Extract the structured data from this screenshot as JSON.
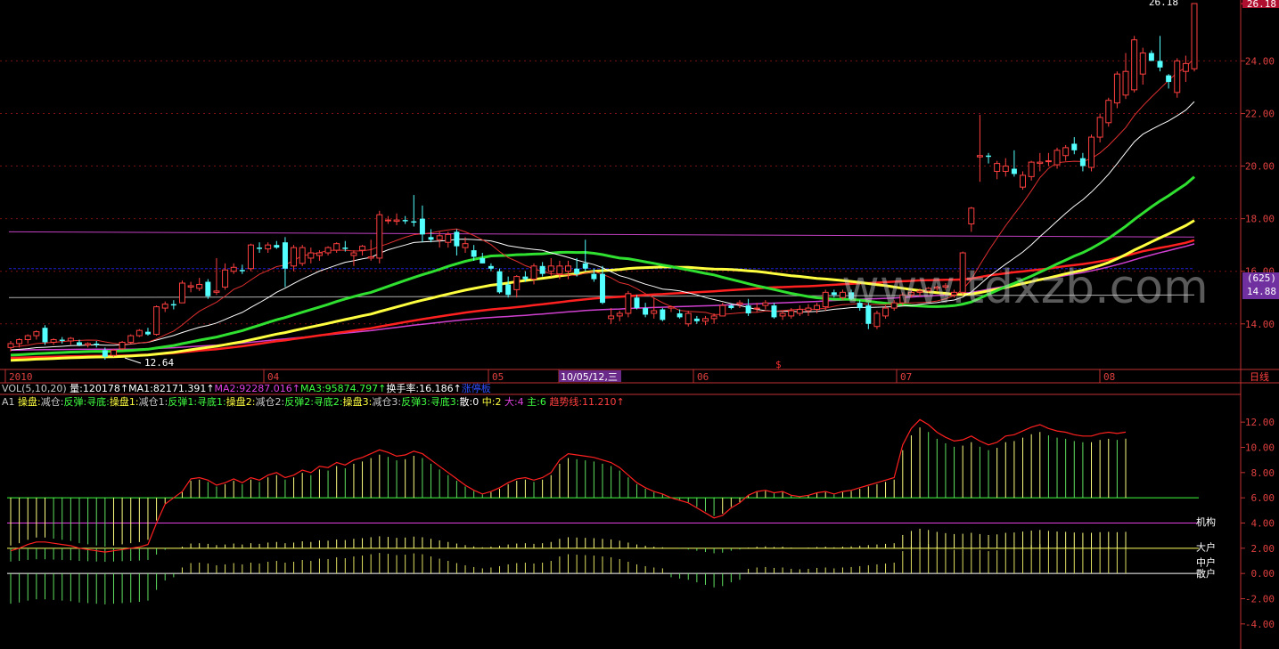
{
  "chart_data": [
    {
      "type": "candlestick",
      "title": "",
      "x_ticks": [
        "2010",
        "04",
        "05",
        "10/05/12,三",
        "06",
        "07",
        "08"
      ],
      "y_ticks": [
        "14.00",
        "16.00",
        "18.00",
        "20.00",
        "22.00",
        "24.00"
      ],
      "ylim": [
        12.3,
        26.18
      ],
      "price_labels": {
        "high": "26.18",
        "low": "12.64",
        "current": "14.88",
        "count": "(625)"
      },
      "watermark": "www.tdxzb.com",
      "period_label": "日线",
      "marker": "$",
      "candles": [
        [
          13.1,
          13.35,
          12.95,
          13.25
        ],
        [
          13.25,
          13.45,
          13.1,
          13.4
        ],
        [
          13.4,
          13.6,
          13.25,
          13.55
        ],
        [
          13.55,
          13.75,
          13.4,
          13.7
        ],
        [
          13.85,
          13.95,
          13.2,
          13.3
        ],
        [
          13.3,
          13.45,
          13.2,
          13.4
        ],
        [
          13.4,
          13.5,
          13.25,
          13.35
        ],
        [
          13.35,
          13.5,
          13.2,
          13.45
        ],
        [
          13.3,
          13.4,
          13.15,
          13.2
        ],
        [
          13.2,
          13.3,
          13.1,
          13.25
        ],
        [
          13.25,
          13.35,
          13.1,
          13.2
        ],
        [
          13.0,
          13.1,
          12.64,
          12.75
        ],
        [
          12.8,
          13.05,
          12.75,
          13.0
        ],
        [
          13.05,
          13.35,
          13.0,
          13.3
        ],
        [
          13.3,
          13.6,
          13.25,
          13.55
        ],
        [
          13.55,
          13.8,
          13.5,
          13.75
        ],
        [
          13.7,
          13.85,
          13.55,
          13.6
        ],
        [
          13.6,
          14.7,
          13.55,
          14.65
        ],
        [
          14.6,
          14.85,
          14.45,
          14.75
        ],
        [
          14.75,
          14.9,
          14.55,
          14.7
        ],
        [
          14.8,
          15.65,
          14.8,
          15.55
        ],
        [
          15.4,
          15.6,
          15.2,
          15.45
        ],
        [
          15.35,
          15.75,
          15.25,
          15.5
        ],
        [
          15.6,
          15.7,
          14.95,
          15.05
        ],
        [
          15.2,
          16.5,
          15.1,
          15.25
        ],
        [
          15.4,
          16.3,
          15.3,
          16.05
        ],
        [
          16.0,
          16.3,
          15.9,
          16.15
        ],
        [
          16.05,
          16.25,
          15.9,
          16.0
        ],
        [
          16.1,
          17.05,
          16.0,
          17.0
        ],
        [
          16.9,
          17.1,
          16.7,
          16.85
        ],
        [
          16.85,
          17.1,
          16.7,
          17.0
        ],
        [
          17.0,
          17.15,
          16.85,
          16.9
        ],
        [
          17.1,
          17.3,
          15.4,
          16.1
        ],
        [
          16.2,
          17.0,
          16.0,
          16.9
        ],
        [
          16.3,
          17.0,
          16.2,
          16.9
        ],
        [
          16.5,
          16.9,
          16.3,
          16.7
        ],
        [
          16.6,
          16.8,
          16.4,
          16.7
        ],
        [
          16.7,
          16.95,
          16.6,
          16.9
        ],
        [
          16.8,
          17.1,
          16.7,
          17.05
        ],
        [
          16.9,
          17.15,
          16.75,
          16.85
        ],
        [
          16.6,
          16.8,
          16.2,
          16.7
        ],
        [
          16.8,
          17.0,
          16.6,
          16.95
        ],
        [
          16.5,
          17.2,
          16.4,
          16.55
        ],
        [
          16.5,
          18.3,
          16.3,
          18.15
        ],
        [
          17.95,
          18.1,
          17.8,
          17.95
        ],
        [
          17.9,
          18.2,
          17.75,
          17.95
        ],
        [
          17.95,
          18.1,
          17.8,
          17.9
        ],
        [
          17.9,
          18.9,
          17.7,
          17.85
        ],
        [
          18.0,
          18.5,
          17.1,
          17.4
        ],
        [
          17.3,
          17.6,
          17.1,
          17.2
        ],
        [
          17.2,
          17.5,
          16.9,
          17.35
        ],
        [
          17.1,
          17.5,
          16.9,
          17.4
        ],
        [
          17.5,
          17.6,
          16.6,
          16.95
        ],
        [
          16.9,
          17.3,
          16.7,
          17.05
        ],
        [
          16.8,
          17.0,
          16.4,
          16.55
        ],
        [
          16.5,
          16.7,
          16.3,
          16.3
        ],
        [
          16.2,
          16.3,
          16.0,
          16.1
        ],
        [
          16.0,
          16.1,
          15.15,
          15.2
        ],
        [
          15.5,
          15.8,
          15.0,
          15.1
        ],
        [
          15.3,
          15.85,
          15.0,
          15.8
        ],
        [
          15.8,
          16.0,
          15.6,
          15.7
        ],
        [
          15.7,
          16.3,
          15.5,
          16.2
        ],
        [
          16.2,
          16.35,
          15.8,
          15.9
        ],
        [
          16.0,
          16.5,
          15.8,
          16.2
        ],
        [
          15.9,
          16.4,
          15.7,
          16.2
        ],
        [
          16.0,
          16.4,
          15.7,
          16.2
        ],
        [
          16.1,
          16.5,
          15.8,
          15.9
        ],
        [
          16.3,
          17.2,
          16.0,
          16.1
        ],
        [
          15.9,
          16.1,
          15.6,
          15.7
        ],
        [
          15.9,
          16.2,
          14.75,
          14.8
        ],
        [
          14.2,
          14.6,
          14.0,
          14.3
        ],
        [
          14.3,
          14.5,
          14.1,
          14.4
        ],
        [
          14.4,
          15.25,
          14.25,
          15.15
        ],
        [
          15.0,
          15.1,
          14.55,
          14.6
        ],
        [
          14.6,
          14.8,
          14.25,
          14.35
        ],
        [
          14.4,
          15.0,
          14.2,
          14.5
        ],
        [
          14.55,
          14.6,
          14.1,
          14.15
        ],
        [
          14.6,
          14.7,
          14.45,
          14.65
        ],
        [
          14.4,
          14.55,
          14.2,
          14.25
        ],
        [
          14.0,
          14.5,
          13.9,
          14.4
        ],
        [
          14.2,
          14.3,
          14.0,
          14.1
        ],
        [
          14.1,
          14.3,
          13.95,
          14.2
        ],
        [
          14.2,
          14.4,
          14.0,
          14.3
        ],
        [
          14.3,
          14.8,
          14.3,
          14.7
        ],
        [
          14.7,
          14.75,
          14.55,
          14.6
        ],
        [
          14.75,
          14.9,
          14.6,
          14.8
        ],
        [
          14.7,
          14.95,
          14.3,
          14.4
        ],
        [
          14.6,
          14.8,
          14.45,
          14.6
        ],
        [
          14.7,
          14.9,
          14.55,
          14.8
        ],
        [
          14.7,
          14.8,
          14.2,
          14.25
        ],
        [
          14.3,
          14.5,
          14.15,
          14.4
        ],
        [
          14.3,
          14.6,
          14.2,
          14.5
        ],
        [
          14.4,
          14.7,
          14.3,
          14.55
        ],
        [
          14.5,
          14.75,
          14.3,
          14.6
        ],
        [
          14.55,
          14.8,
          14.4,
          14.7
        ],
        [
          14.65,
          15.3,
          14.5,
          15.2
        ],
        [
          15.2,
          15.3,
          15.0,
          15.1
        ],
        [
          15.0,
          15.3,
          14.9,
          15.2
        ],
        [
          15.2,
          15.3,
          14.9,
          14.95
        ],
        [
          14.8,
          14.9,
          14.5,
          14.6
        ],
        [
          14.7,
          14.8,
          13.8,
          14.0
        ],
        [
          13.9,
          14.5,
          13.8,
          14.4
        ],
        [
          14.3,
          14.7,
          14.2,
          14.6
        ],
        [
          14.6,
          14.9,
          14.5,
          14.8
        ],
        [
          14.8,
          15.2,
          14.7,
          15.1
        ],
        [
          15.1,
          15.3,
          15.0,
          15.2
        ],
        [
          15.2,
          15.35,
          15.05,
          15.25
        ],
        [
          15.25,
          15.4,
          15.2,
          15.35
        ],
        [
          15.35,
          15.45,
          15.25,
          15.4
        ],
        [
          15.4,
          15.55,
          15.3,
          15.45
        ],
        [
          15.1,
          15.3,
          15.0,
          15.2
        ],
        [
          15.2,
          16.75,
          15.1,
          16.7
        ],
        [
          17.8,
          18.45,
          17.5,
          18.4
        ],
        [
          20.35,
          21.95,
          19.4,
          20.4
        ],
        [
          20.4,
          20.5,
          20.1,
          20.35
        ],
        [
          19.8,
          20.2,
          19.5,
          20.1
        ],
        [
          19.8,
          20.3,
          19.6,
          20.0
        ],
        [
          19.9,
          20.6,
          19.6,
          19.7
        ],
        [
          19.2,
          19.8,
          19.1,
          19.65
        ],
        [
          19.6,
          20.2,
          19.45,
          20.15
        ],
        [
          20.1,
          20.5,
          19.8,
          20.15
        ],
        [
          20.2,
          20.5,
          20.0,
          20.2
        ],
        [
          20.05,
          20.7,
          19.9,
          20.6
        ],
        [
          20.4,
          20.8,
          20.2,
          20.7
        ],
        [
          20.85,
          21.1,
          20.45,
          20.6
        ],
        [
          20.3,
          20.5,
          19.8,
          20.0
        ],
        [
          19.95,
          21.2,
          19.8,
          21.1
        ],
        [
          21.1,
          22.0,
          20.9,
          21.85
        ],
        [
          21.65,
          22.6,
          21.5,
          22.5
        ],
        [
          22.4,
          23.6,
          22.2,
          23.5
        ],
        [
          22.7,
          24.3,
          22.55,
          23.6
        ],
        [
          22.9,
          24.95,
          22.8,
          24.8
        ],
        [
          23.5,
          24.5,
          23.1,
          24.3
        ],
        [
          24.3,
          24.4,
          24.0,
          24.0
        ],
        [
          24.0,
          24.95,
          23.6,
          23.75
        ],
        [
          23.45,
          23.5,
          22.95,
          23.2
        ],
        [
          22.8,
          24.1,
          22.6,
          24.0
        ],
        [
          23.6,
          24.2,
          23.2,
          23.9
        ],
        [
          23.7,
          26.18,
          23.6,
          26.18
        ]
      ],
      "long_lines": {
        "magenta_top": [
          17.5,
          17.3
        ],
        "blue": [
          16.1,
          16.1
        ],
        "gray": [
          15.0,
          15.1
        ]
      }
    },
    {
      "type": "bar",
      "title": "VOL(5,10,20)",
      "legend": [
        {
          "text": "VOL(5,10,20)",
          "color": "#c8c8c8"
        },
        {
          "text": " 量:120178↑",
          "color": "#ffffff"
        },
        {
          "text": "MA1:82171.391↑",
          "color": "#ffffff"
        },
        {
          "text": "MA2:92287.016↑",
          "color": "#e040e0"
        },
        {
          "text": "MA3:95874.797↑",
          "color": "#40ff40"
        },
        {
          "text": "换手率:16.186↑",
          "color": "#ffffff"
        },
        {
          "text": "涨停板",
          "color": "#3050ff"
        }
      ],
      "legend2": [
        {
          "text": "A1 ",
          "color": "#c8c8c8"
        },
        {
          "text": "操盘:",
          "color": "#ffff40"
        },
        {
          "text": "减仓:",
          "color": "#c8c8c8"
        },
        {
          "text": "反弹:",
          "color": "#40ff40"
        },
        {
          "text": "寻底:",
          "color": "#40ff40"
        },
        {
          "text": "操盘1:",
          "color": "#ffff40"
        },
        {
          "text": "减仓1:",
          "color": "#c8c8c8"
        },
        {
          "text": "反弹1:",
          "color": "#40ff40"
        },
        {
          "text": "寻底1:",
          "color": "#40ff40"
        },
        {
          "text": "操盘2:",
          "color": "#ffff40"
        },
        {
          "text": "减仓2:",
          "color": "#c8c8c8"
        },
        {
          "text": "反弹2:",
          "color": "#40ff40"
        },
        {
          "text": "寻底2:",
          "color": "#40ff40"
        },
        {
          "text": "操盘3:",
          "color": "#ffff40"
        },
        {
          "text": "减仓3:",
          "color": "#c8c8c8"
        },
        {
          "text": "反弹3:",
          "color": "#40ff40"
        },
        {
          "text": "寻底3:",
          "color": "#40ff40"
        },
        {
          "text": "散:0",
          "color": "#ffffff"
        },
        {
          "text": " 中:2",
          "color": "#ffff40"
        },
        {
          "text": " 大:4",
          "color": "#e040e0"
        },
        {
          "text": " 主:6",
          "color": "#40ff40"
        },
        {
          "text": " 趋势线:11.210↑",
          "color": "#ff4040"
        }
      ],
      "y_ticks": [
        "12.00",
        "10.00",
        "8.00",
        "6.00",
        "4.00",
        "2.00",
        "0.00",
        "-2.00",
        "-4.00"
      ],
      "ylim": [
        -5.0,
        13.0
      ],
      "levels": [
        {
          "value": 6,
          "name": "主",
          "color": "#40ff40"
        },
        {
          "value": 4,
          "name": "机构",
          "color": "#e040e0"
        },
        {
          "value": 2,
          "name": "大户",
          "color": "#ffff60"
        },
        {
          "value": 0,
          "name": "",
          "color": "#ffffff"
        }
      ],
      "level_labels": [
        "机构",
        "大户",
        "中户",
        "散户"
      ],
      "trend": [
        1.8,
        2.0,
        2.3,
        2.5,
        2.5,
        2.4,
        2.3,
        2.2,
        2.0,
        1.9,
        1.8,
        1.7,
        1.8,
        1.9,
        2.0,
        2.1,
        2.3,
        4.0,
        5.5,
        6.0,
        6.5,
        7.5,
        7.6,
        7.4,
        7.0,
        7.2,
        7.5,
        7.2,
        7.6,
        7.4,
        7.8,
        8.0,
        7.6,
        7.8,
        8.2,
        8.0,
        8.5,
        8.4,
        8.8,
        8.6,
        9.0,
        9.2,
        9.5,
        9.8,
        9.6,
        9.3,
        9.4,
        9.7,
        9.5,
        9.0,
        8.5,
        8.0,
        7.5,
        7.0,
        6.6,
        6.3,
        6.5,
        6.8,
        7.2,
        7.5,
        7.6,
        7.4,
        7.6,
        8.0,
        9.0,
        9.5,
        9.4,
        9.3,
        9.2,
        9.0,
        8.8,
        8.4,
        7.8,
        7.2,
        6.8,
        6.5,
        6.3,
        6.0,
        5.8,
        5.6,
        5.2,
        4.8,
        4.4,
        4.6,
        5.2,
        5.6,
        6.2,
        6.5,
        6.6,
        6.4,
        6.5,
        6.2,
        6.1,
        6.2,
        6.4,
        6.5,
        6.3,
        6.5,
        6.6,
        6.8,
        7.0,
        7.2,
        7.4,
        7.6,
        10.2,
        11.5,
        12.2,
        11.8,
        11.2,
        10.8,
        10.5,
        10.6,
        10.9,
        10.5,
        10.2,
        10.4,
        10.9,
        11.0,
        11.3,
        11.6,
        11.8,
        11.5,
        11.3,
        11.2,
        11.0,
        10.9,
        10.9,
        11.1,
        11.2,
        11.1,
        11.21
      ]
    }
  ]
}
